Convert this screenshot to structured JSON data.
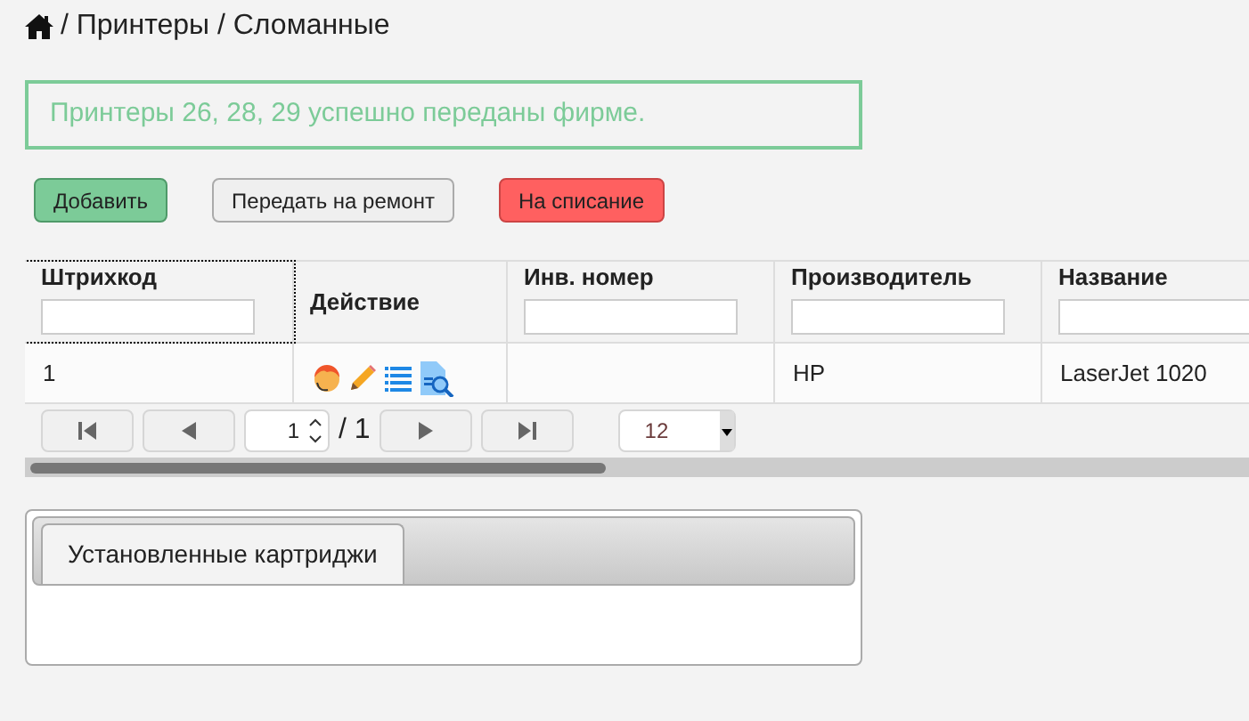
{
  "breadcrumb": [
    "/ Принтеры / Сломанные"
  ],
  "alert": "Принтеры 26, 28, 29 успешно переданы фирме.",
  "buttons": [
    {
      "label": "Добавить",
      "kind": "success"
    },
    {
      "label": "Передать на ремонт",
      "kind": "default"
    },
    {
      "label": "На списание",
      "kind": "danger"
    }
  ],
  "table": {
    "columns": [
      {
        "label": "Штрихкод",
        "filter": true,
        "selected": true
      },
      {
        "label": "Действие",
        "filter": false,
        "selected": false
      },
      {
        "label": "Инв. номер",
        "filter": true,
        "selected": false
      },
      {
        "label": "Производитель",
        "filter": true,
        "selected": false
      },
      {
        "label": "Название",
        "filter": true,
        "selected": false
      }
    ],
    "rows": [
      {
        "cells": [
          "1",
          "",
          "",
          "HP",
          "LaserJet 1020"
        ]
      }
    ]
  },
  "pager": {
    "page": "1",
    "total": "/ 1",
    "page_size": "12"
  },
  "tabs": [
    {
      "label": "Установленные картриджи",
      "selected": true
    }
  ]
}
